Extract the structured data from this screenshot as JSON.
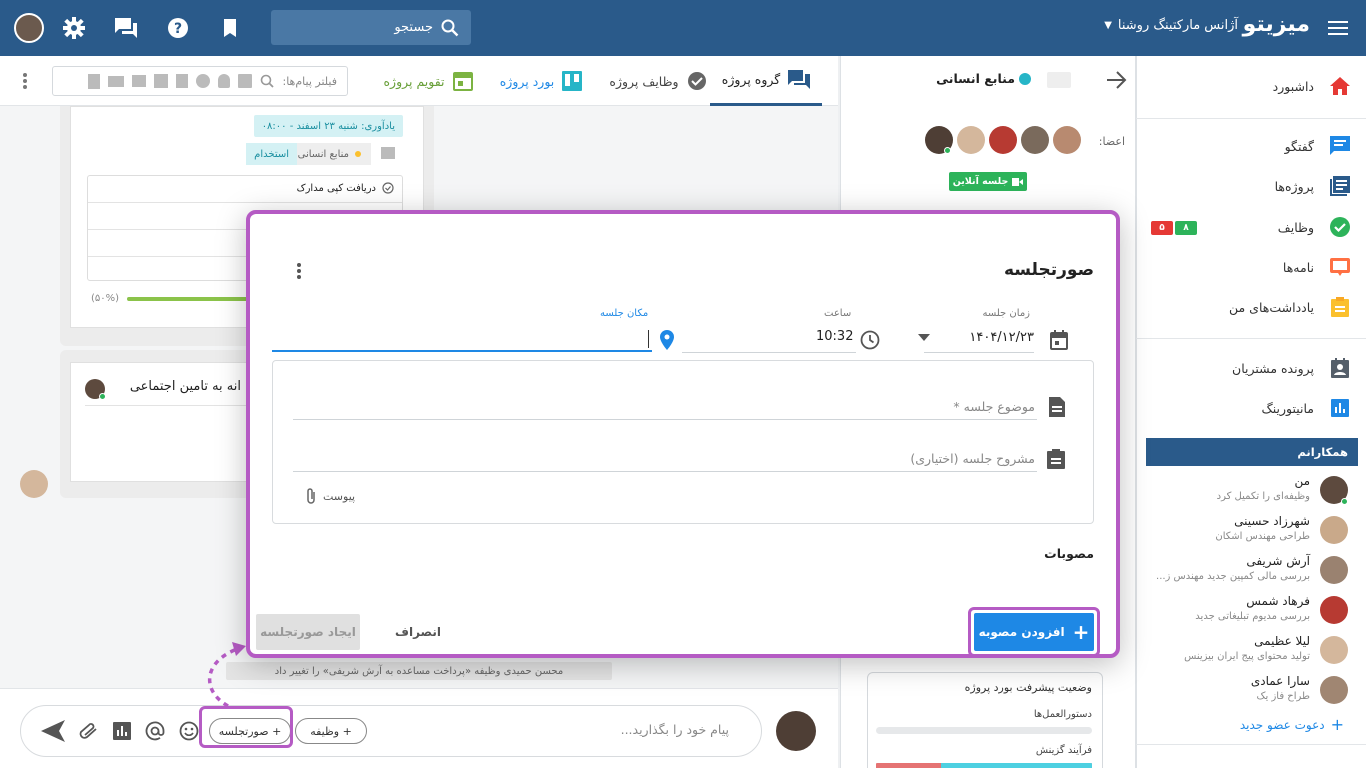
{
  "topbar": {
    "brand": "میزیتو",
    "agency": "آژانس مارکتینگ روشنا",
    "search_placeholder": "جستجو"
  },
  "sidebar": {
    "items": [
      {
        "label": "داشبورد",
        "icon": "home-icon",
        "color": "#e53935"
      },
      {
        "label": "گفتگو",
        "icon": "chat-icon",
        "color": "#1e88e5"
      },
      {
        "label": "پروژه‌ها",
        "icon": "projects-icon",
        "color": "#2a5a8a"
      },
      {
        "label": "وظایف",
        "icon": "check-circle-icon",
        "color": "#2db35a"
      },
      {
        "label": "نامه‌ها",
        "icon": "letter-icon",
        "color": "#ff7043"
      },
      {
        "label": "یادداشت‌های من",
        "icon": "note-icon",
        "color": "#fbc02d"
      },
      {
        "label": "پرونده مشتریان",
        "icon": "contact-icon",
        "color": "#555f6a"
      },
      {
        "label": "مانیتورینگ",
        "icon": "chart-icon",
        "color": "#1e88e5"
      }
    ],
    "task_badges": {
      "green": "۸",
      "red": "۵"
    },
    "colleagues_title": "همکارانم",
    "colleagues": [
      {
        "name": "من",
        "status": "وظیفه‌ای را تکمیل کرد"
      },
      {
        "name": "شهرزاد حسینی",
        "status": "طراحی مهندس اشکان"
      },
      {
        "name": "آرش شریفی",
        "status": "بررسی مالی کمپین جدید مهندس ز..."
      },
      {
        "name": "فرهاد شمس",
        "status": "بررسی مدیوم تبلیغاتی جدید"
      },
      {
        "name": "لیلا عظیمی",
        "status": "تولید محتوای پیج ایران بیزینس"
      },
      {
        "name": "سارا عمادی",
        "status": "طراح فاز یک"
      }
    ],
    "invite": "دعوت عضو جدید"
  },
  "group": {
    "title": "منابع انسانی",
    "members_label": "اعضا:",
    "online_meeting": "جلسه آنلاین",
    "progress_title": "وضعیت پیشرفت بورد پروژه",
    "progress_items": [
      {
        "label": "دستورالعمل‌ها",
        "value": 0
      },
      {
        "label": "فرآیند گزینش",
        "value": 0.7
      }
    ]
  },
  "tabs": [
    {
      "label": "گروه پروژه",
      "icon": "chat-icon",
      "active": true
    },
    {
      "label": "وظایف پروژه",
      "icon": "check-circle-icon",
      "active": false
    },
    {
      "label": "بورد پروژه",
      "icon": "board-icon",
      "active": false
    },
    {
      "label": "تقویم پروژه",
      "icon": "calendar-icon",
      "active": false
    }
  ],
  "filter_placeholder": "فیلتر پیام‌ها:",
  "chat": {
    "reminder": "یادآوری: شنبه ۲۳ اسفند - ۰۸:۰۰",
    "tag_group": "منابع انسانی",
    "tag_label": "استخدام",
    "checklist_first": "دریافت کپی مدارک",
    "progress_percent": "(۵۰%)",
    "progress_value": 0.5,
    "card2_text": "انه به تامین اجتماعی",
    "system_msg": "محسن حمیدی وظیفه «پرداخت مساعده به آرش شریفی» را تغییر داد"
  },
  "composer": {
    "placeholder": "پیام خود را بگذارید...",
    "chip_task": "+ وظیفه",
    "chip_minutes": "+ صورتجلسه"
  },
  "modal": {
    "title": "صورتجلسه",
    "date_label": "زمان جلسه",
    "date_value": "۱۴۰۴/۱۲/۲۳",
    "time_label": "ساعت",
    "time_value": "10:32",
    "location_label": "مکان جلسه",
    "subject_placeholder": "موضوع جلسه *",
    "details_placeholder": "مشروح جلسه (اختیاری)",
    "attachment": "پیوست",
    "resolutions": "مصوبات",
    "add_resolution": "افزودن مصوبه",
    "cancel": "انصراف",
    "create": "ایجاد صورتجلسه"
  }
}
